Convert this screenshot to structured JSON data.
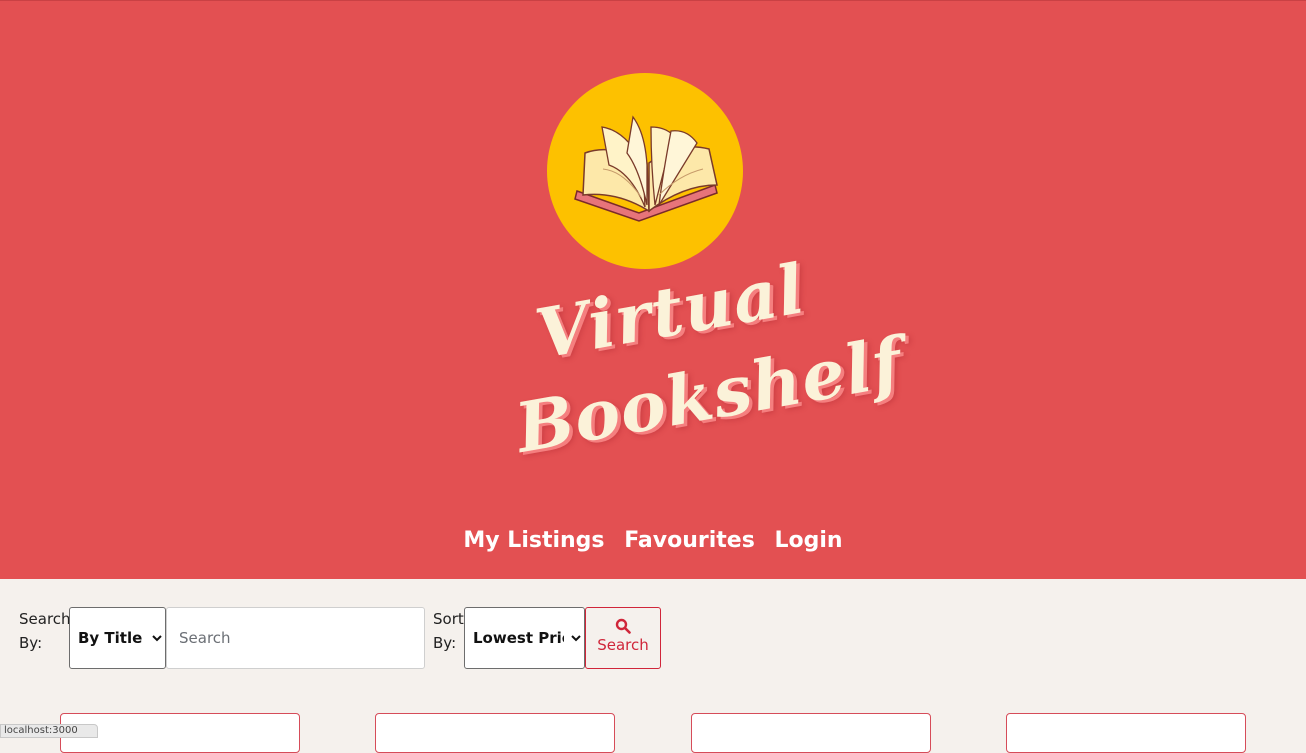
{
  "header": {
    "title_line1": "Virtual",
    "title_line2": "Bookshelf",
    "logo_icon": "open-book-icon",
    "colors": {
      "background": "#e35052",
      "logo_circle": "#fdc100",
      "title_text": "#fbf2d9"
    }
  },
  "nav": {
    "items": [
      {
        "label": "My Listings"
      },
      {
        "label": "Favourites"
      },
      {
        "label": "Login"
      }
    ]
  },
  "search": {
    "search_by_label": "Search By:",
    "search_by_value": "By Title",
    "query_placeholder": "Search",
    "sort_by_label": "Sort By:",
    "sort_by_value": "Lowest Price",
    "button_label": "Search",
    "button_icon": "magnifier-icon",
    "accent_color": "#d0263a"
  },
  "status_bar": {
    "text": "localhost:3000"
  }
}
